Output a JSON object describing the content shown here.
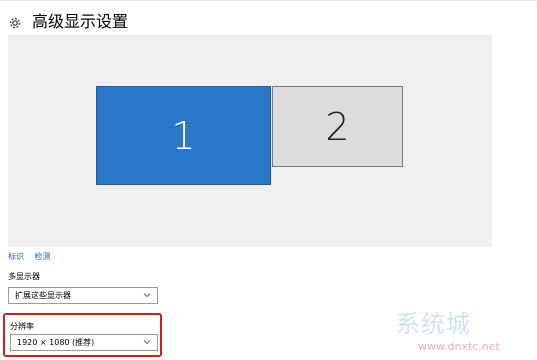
{
  "header": {
    "title": "高级显示设置",
    "icon": "gear-icon"
  },
  "monitors": [
    {
      "label": "1",
      "selected": true,
      "color": "#2a78c8"
    },
    {
      "label": "2",
      "selected": false,
      "color": "#dcdcdc"
    }
  ],
  "links": {
    "identify": "标识",
    "detect": "检测"
  },
  "multiple_displays": {
    "label": "多显示器",
    "value": "扩展这些显示器"
  },
  "resolution": {
    "label": "分辨率",
    "value": "1920 × 1080 (推荐)",
    "highlight_color": "#d01e1e"
  },
  "watermark": {
    "text": "系统城",
    "url": "www.dnxtc.net"
  }
}
